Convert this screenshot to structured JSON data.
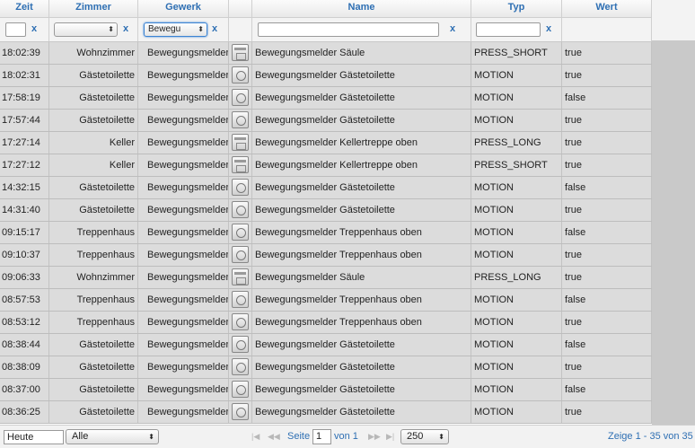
{
  "columns": [
    "Zeit",
    "Zimmer",
    "Gewerk",
    "",
    "Name",
    "Typ",
    "Wert"
  ],
  "filters": {
    "zimmer_value": "",
    "gewerk_value": "Bewegu",
    "clear_label": "x"
  },
  "rows": [
    {
      "zeit": "18:02:39",
      "zimmer": "Wohnzimmer",
      "gewerk": "Bewegungsmelder",
      "icon": "switch-icon",
      "name": "Bewegungsmelder Säule",
      "typ": "PRESS_SHORT",
      "wert": "true"
    },
    {
      "zeit": "18:02:31",
      "zimmer": "Gästetoilette",
      "gewerk": "Bewegungsmelder",
      "icon": "motion-sensor-icon",
      "name": "Bewegungsmelder Gästetoilette",
      "typ": "MOTION",
      "wert": "true"
    },
    {
      "zeit": "17:58:19",
      "zimmer": "Gästetoilette",
      "gewerk": "Bewegungsmelder",
      "icon": "motion-sensor-icon",
      "name": "Bewegungsmelder Gästetoilette",
      "typ": "MOTION",
      "wert": "false"
    },
    {
      "zeit": "17:57:44",
      "zimmer": "Gästetoilette",
      "gewerk": "Bewegungsmelder",
      "icon": "motion-sensor-icon",
      "name": "Bewegungsmelder Gästetoilette",
      "typ": "MOTION",
      "wert": "true"
    },
    {
      "zeit": "17:27:14",
      "zimmer": "Keller",
      "gewerk": "Bewegungsmelder",
      "icon": "switch-icon",
      "name": "Bewegungsmelder Kellertreppe oben",
      "typ": "PRESS_LONG",
      "wert": "true"
    },
    {
      "zeit": "17:27:12",
      "zimmer": "Keller",
      "gewerk": "Bewegungsmelder",
      "icon": "switch-icon",
      "name": "Bewegungsmelder Kellertreppe oben",
      "typ": "PRESS_SHORT",
      "wert": "true"
    },
    {
      "zeit": "14:32:15",
      "zimmer": "Gästetoilette",
      "gewerk": "Bewegungsmelder",
      "icon": "motion-sensor-icon",
      "name": "Bewegungsmelder Gästetoilette",
      "typ": "MOTION",
      "wert": "false"
    },
    {
      "zeit": "14:31:40",
      "zimmer": "Gästetoilette",
      "gewerk": "Bewegungsmelder",
      "icon": "motion-sensor-icon",
      "name": "Bewegungsmelder Gästetoilette",
      "typ": "MOTION",
      "wert": "true"
    },
    {
      "zeit": "09:15:17",
      "zimmer": "Treppenhaus",
      "gewerk": "Bewegungsmelder",
      "icon": "motion-sensor-icon",
      "name": "Bewegungsmelder Treppenhaus oben",
      "typ": "MOTION",
      "wert": "false"
    },
    {
      "zeit": "09:10:37",
      "zimmer": "Treppenhaus",
      "gewerk": "Bewegungsmelder",
      "icon": "motion-sensor-icon",
      "name": "Bewegungsmelder Treppenhaus oben",
      "typ": "MOTION",
      "wert": "true"
    },
    {
      "zeit": "09:06:33",
      "zimmer": "Wohnzimmer",
      "gewerk": "Bewegungsmelder",
      "icon": "switch-icon",
      "name": "Bewegungsmelder Säule",
      "typ": "PRESS_LONG",
      "wert": "true"
    },
    {
      "zeit": "08:57:53",
      "zimmer": "Treppenhaus",
      "gewerk": "Bewegungsmelder",
      "icon": "motion-sensor-icon",
      "name": "Bewegungsmelder Treppenhaus oben",
      "typ": "MOTION",
      "wert": "false"
    },
    {
      "zeit": "08:53:12",
      "zimmer": "Treppenhaus",
      "gewerk": "Bewegungsmelder",
      "icon": "motion-sensor-icon",
      "name": "Bewegungsmelder Treppenhaus oben",
      "typ": "MOTION",
      "wert": "true"
    },
    {
      "zeit": "08:38:44",
      "zimmer": "Gästetoilette",
      "gewerk": "Bewegungsmelder",
      "icon": "motion-sensor-icon",
      "name": "Bewegungsmelder Gästetoilette",
      "typ": "MOTION",
      "wert": "false"
    },
    {
      "zeit": "08:38:09",
      "zimmer": "Gästetoilette",
      "gewerk": "Bewegungsmelder",
      "icon": "motion-sensor-icon",
      "name": "Bewegungsmelder Gästetoilette",
      "typ": "MOTION",
      "wert": "true"
    },
    {
      "zeit": "08:37:00",
      "zimmer": "Gästetoilette",
      "gewerk": "Bewegungsmelder",
      "icon": "motion-sensor-icon",
      "name": "Bewegungsmelder Gästetoilette",
      "typ": "MOTION",
      "wert": "false"
    },
    {
      "zeit": "08:36:25",
      "zimmer": "Gästetoilette",
      "gewerk": "Bewegungsmelder",
      "icon": "motion-sensor-icon",
      "name": "Bewegungsmelder Gästetoilette",
      "typ": "MOTION",
      "wert": "true"
    }
  ],
  "pager": {
    "date_value": "Heute",
    "scope_value": "Alle",
    "page_label": "Seite",
    "page_value": "1",
    "of_label": "von 1",
    "page_size": "250",
    "summary": "Zeige 1 - 35 von 35"
  }
}
